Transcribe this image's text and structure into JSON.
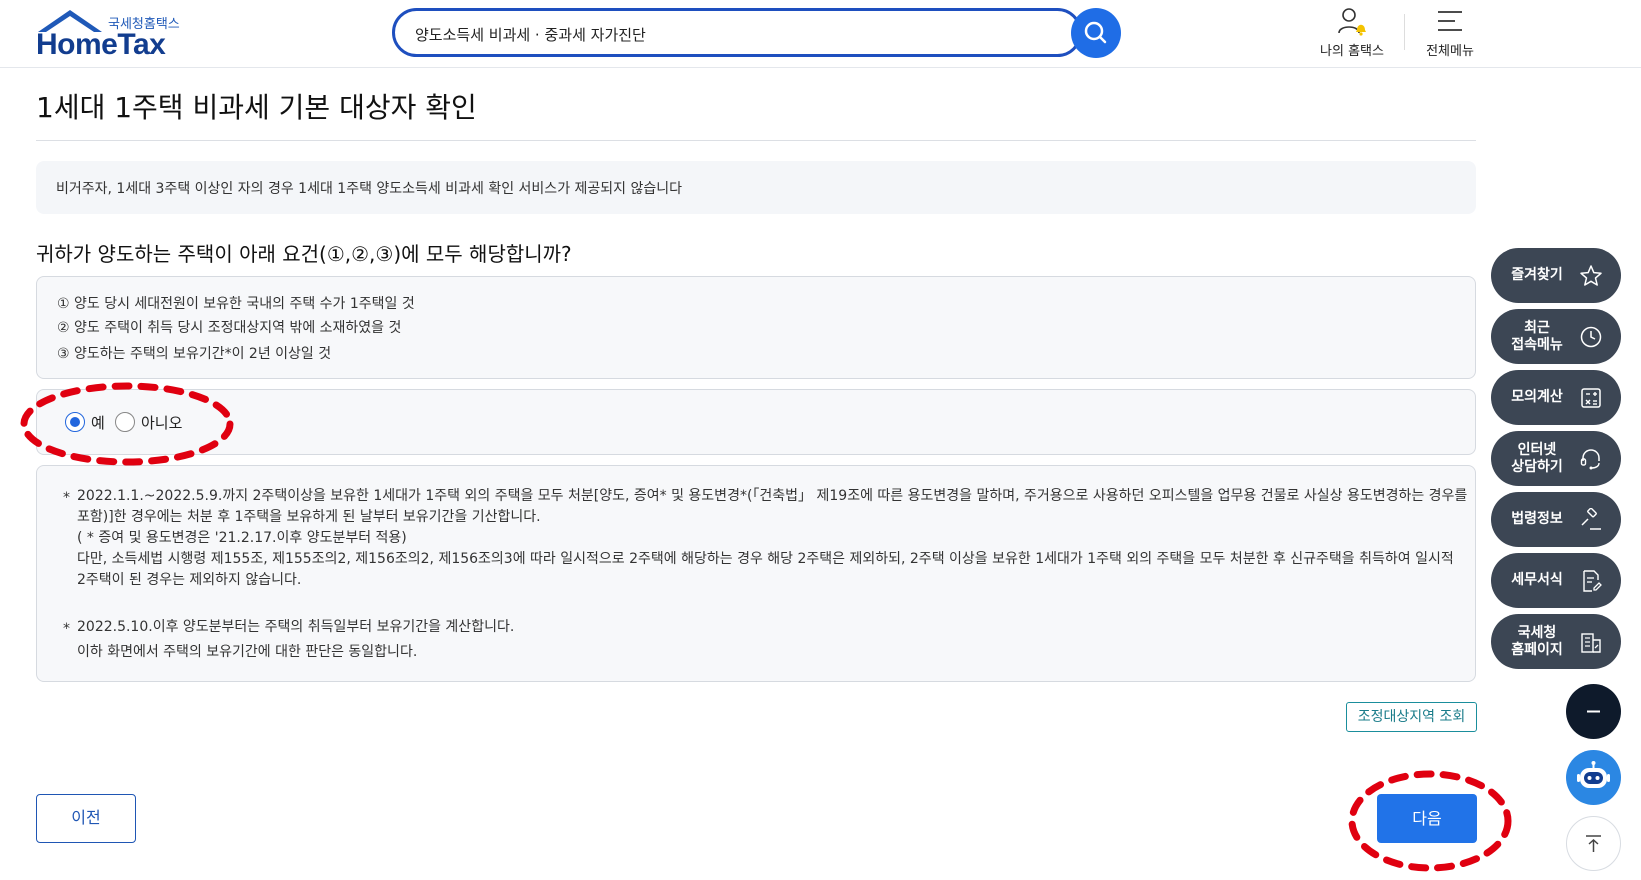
{
  "header": {
    "logo_sub": "국세청홈택스",
    "logo_main": "HomeTax",
    "search_value": "양도소득세 비과세 · 중과세 자가진단",
    "my_hometax": "나의 홈택스",
    "all_menu": "전체메뉴"
  },
  "page": {
    "title": "1세대 1주택 비과세 기본 대상자 확인",
    "notice": "비거주자, 1세대 3주택 이상인 자의 경우 1세대 1주택 양도소득세 비과세 확인 서비스가 제공되지 않습니다",
    "question": "귀하가 양도하는 주택이 아래 요건(①,②,③)에 모두 해당합니까?",
    "requirements": [
      "① 양도 당시 세대전원이 보유한 국내의 주택 수가 1주택일 것",
      "② 양도 주택이 취득 당시 조정대상지역 밖에 소재하였을 것",
      "③ 양도하는 주택의 보유기간*이 2년 이상일 것"
    ],
    "radio_yes": "예",
    "radio_no": "아니오",
    "radio_selected": "예",
    "notes": {
      "star1": "*",
      "line1": "2022.1.1.~2022.5.9.까지 2주택이상을 보유한 1세대가 1주택 외의 주택을 모두 처분[양도, 증여* 및 용도변경*(「건축법」 제19조에 따른 용도변경을 말하며, 주거용으로 사용하던 오피스텔을 업무용 건물로 사실상 용도변경하는 경우를",
      "line2": "포함)]한 경우에는 처분 후 1주택을 보유하게 된 날부터 보유기간을 기산합니다.",
      "line3": "( * 증여 및 용도변경은 '21.2.17.이후 양도분부터 적용)",
      "line4": "다만, 소득세법 시행령 제155조, 제155조의2, 제156조의2, 제156조의3에 따라 일시적으로 2주택에 해당하는 경우 해당 2주택은 제외하되, 2주택 이상을 보유한 1세대가 1주택 외의 주택을 모두 처분한 후 신규주택을 취득하여 일시적",
      "line5": "2주택이 된 경우는 제외하지 않습니다.",
      "star2": "*",
      "line6": "2022.5.10.이후 양도분부터는 주택의 취득일부터 보유기간을 계산합니다.",
      "line7": "이하 화면에서 주택의 보유기간에 대한 판단은 동일합니다."
    },
    "lookup_button": "조정대상지역 조회",
    "prev_button": "이전",
    "next_button": "다음"
  },
  "sidebar": {
    "favorites": "즐겨찾기",
    "recent_line1": "최근",
    "recent_line2": "접속메뉴",
    "simulation": "모의계산",
    "consult_line1": "인터넷",
    "consult_line2": "상담하기",
    "law": "법령정보",
    "forms": "세무서식",
    "nts_line1": "국세청",
    "nts_line2": "홈페이지"
  },
  "colors": {
    "brand": "#123d8f",
    "primary": "#2173e8",
    "side_button": "#3c4654",
    "annotation": "#e00010"
  }
}
